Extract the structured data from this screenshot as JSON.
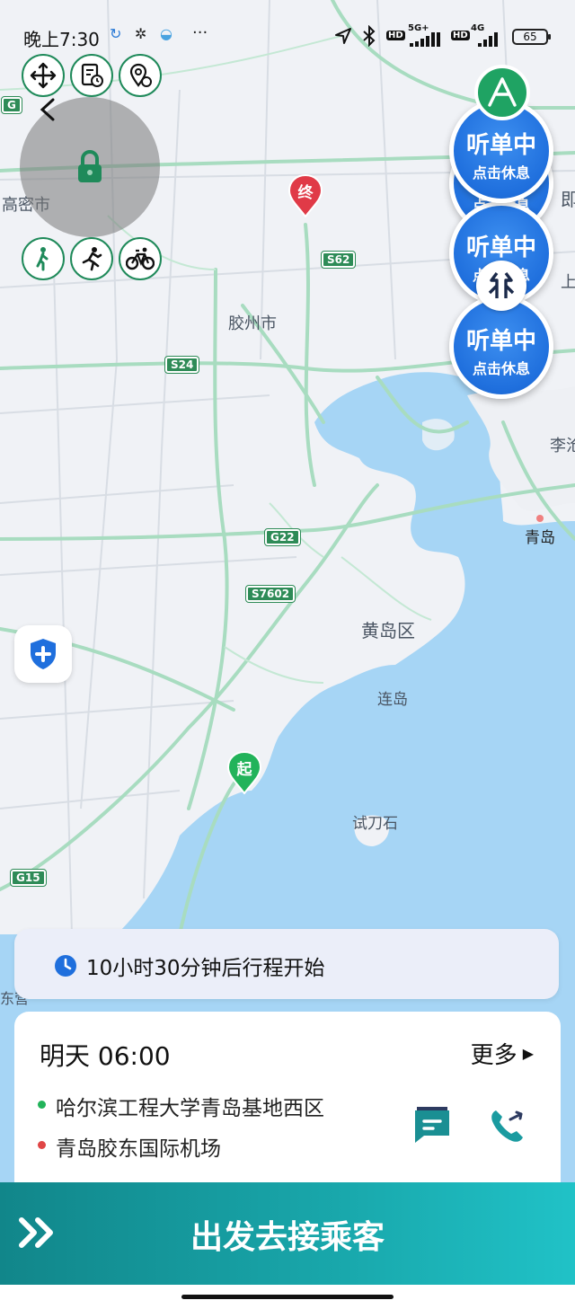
{
  "status_bar": {
    "time": "晚上7:30",
    "more": "···",
    "network_1": "5G+",
    "network_2": "4G",
    "hd": "HD",
    "battery": "65"
  },
  "map": {
    "place_labels": {
      "gaomi": "高密市",
      "jiaozhou": "胶州市",
      "huangdao": "黄岛区",
      "liandao": "连岛",
      "shidaoshi": "试刀石",
      "qingdao": "青岛",
      "licang": "李沧",
      "jimo": "即",
      "edge_right": "上",
      "partial_left": "东营"
    },
    "road_shields": {
      "g15": "G15",
      "s24": "S24",
      "s62": "S62",
      "g22": "G22",
      "s7602": "S7602",
      "g_left": "G"
    },
    "start_pin": "起",
    "end_pin": "终"
  },
  "order_bubbles": [
    {
      "title": "听单中",
      "subtitle": "点击休息"
    },
    {
      "title": "听单中",
      "subtitle": "点击休息"
    },
    {
      "title": "听单中",
      "subtitle": "点击休息"
    }
  ],
  "countdown": {
    "text": "10小时30分钟后行程开始"
  },
  "trip": {
    "time": "明天 06:00",
    "more_label": "更多",
    "origin": "哈尔滨工程大学青岛基地西区",
    "destination": "青岛胶东国际机场"
  },
  "action": {
    "label": "出发去接乘客"
  },
  "colors": {
    "accent_green": "#1f8a5a",
    "bubble_blue": "#1f6fdd",
    "action_teal": "#19a8ac",
    "origin_dot": "#22b35a",
    "dest_dot": "#e04646"
  }
}
